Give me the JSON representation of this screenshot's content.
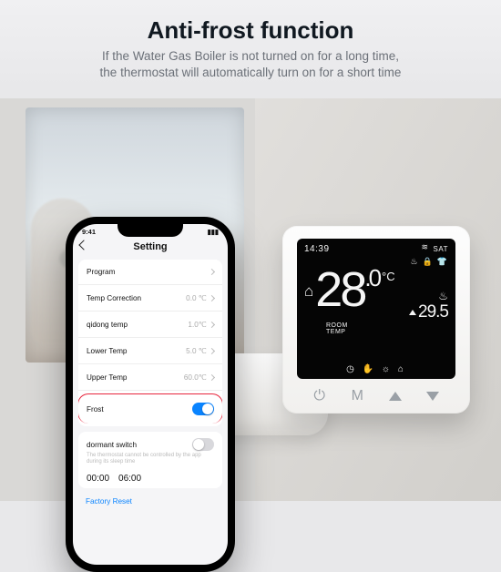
{
  "header": {
    "title": "Anti-frost function",
    "subtitle_line1": "If the Water Gas Boiler is not turned on for a long time,",
    "subtitle_line2": "the thermostat will automatically turn on for a short time"
  },
  "phone": {
    "time": "9:41",
    "screen_title": "Setting",
    "rows": {
      "program": {
        "label": "Program",
        "value": ""
      },
      "temp_correction": {
        "label": "Temp Correction",
        "value": "0.0 ℃"
      },
      "qidong_temp": {
        "label": "qidong temp",
        "value": "1.0℃"
      },
      "lower_temp": {
        "label": "Lower Temp",
        "value": "5.0 ℃"
      },
      "upper_temp": {
        "label": "Upper Temp",
        "value": "60.0℃"
      },
      "frost": {
        "label": "Frost",
        "on": "true"
      },
      "dormant": {
        "label": "dormant switch",
        "on": "false",
        "note": "The thermostat cannot be controlled by the app during its sleep time",
        "t1": "00:00",
        "t2": "06:00"
      }
    },
    "factory_reset": "Factory Reset"
  },
  "thermostat": {
    "clock": "14:39",
    "day": "SAT",
    "room_temp_int": "28",
    "room_temp_dec": ".0",
    "unit": "°C",
    "set_temp": "29.5",
    "room_label_1": "ROOM",
    "room_label_2": "TEMP",
    "btn_mode": "M",
    "icons": {
      "flame": "♨",
      "lock": "🔒",
      "shirt": "👕",
      "home": "⌂",
      "wifi": "≋",
      "clock": "◷",
      "hand": "✋",
      "sun": "☼",
      "house2": "⌂"
    }
  }
}
